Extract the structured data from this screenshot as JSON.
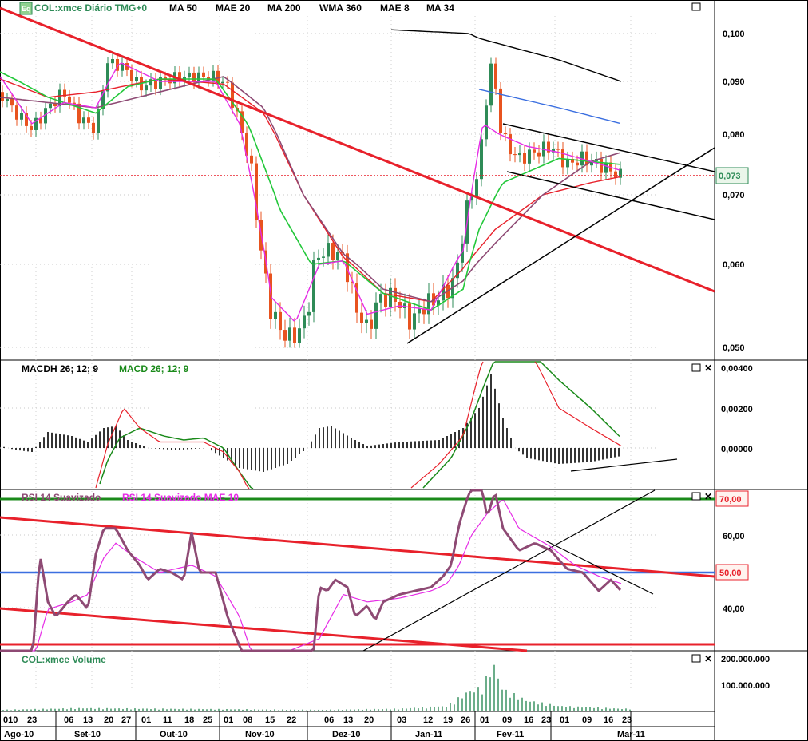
{
  "header": {
    "symbol": "COL:xmce Diário TMG+0",
    "indicators": [
      {
        "label": "MA 50",
        "color": "#e8212b"
      },
      {
        "label": "MAE 20",
        "color": "#23c83a"
      },
      {
        "label": "MA 200",
        "color": "#3b6fe0"
      },
      {
        "label": "WMA 360",
        "color": "#000000"
      },
      {
        "label": "MAE 8",
        "color": "#e62ce6"
      },
      {
        "label": "MA 34",
        "color": "#8e4a74"
      }
    ]
  },
  "panels": {
    "macd": {
      "labels": [
        {
          "label": "MACDH 26; 12; 9",
          "color": "#000000"
        },
        {
          "label": "MACD 26; 12; 9",
          "color": "#1a8a1a"
        }
      ]
    },
    "rsi": {
      "labels": [
        {
          "label": "RSI 14 Suavizado",
          "color": "#8e4a74"
        },
        {
          "label": "RSI 14 Suavizado MAE 10",
          "color": "#e62ce6"
        }
      ]
    },
    "volume": {
      "label": "COL:xmce Volume"
    }
  },
  "axes": {
    "price_ticks": [
      "0,100",
      "0,090",
      "0,080",
      "0,070",
      "0,060",
      "0,050"
    ],
    "price_last": "0,073",
    "macd_ticks": [
      "0,00400",
      "0,00200",
      "0,00000"
    ],
    "rsi_ticks": [
      "60,00",
      "40,00"
    ],
    "rsi_levels": [
      "70,00",
      "50,00"
    ],
    "volume_ticks": [
      "200.000.000",
      "100.000.000"
    ],
    "day_labels": [
      "010",
      "23",
      "06",
      "13",
      "20",
      "27",
      "01",
      "11",
      "18",
      "25",
      "01",
      "08",
      "15",
      "22",
      "06",
      "13",
      "20",
      "03",
      "12",
      "19",
      "26",
      "01",
      "09",
      "16",
      "23",
      "01",
      "09",
      "16",
      "23"
    ],
    "month_labels": [
      "Ago-10",
      "Set-10",
      "Out-10",
      "Nov-10",
      "Dez-10",
      "Jan-11",
      "Fev-11",
      "Mar-11"
    ]
  },
  "colors": {
    "ma50": "#e8212b",
    "mae20": "#23c83a",
    "ma200": "#3b6fe0",
    "wma360": "#000000",
    "mae8": "#e62ce6",
    "ma34": "#8e4a74",
    "up": "#2e8b57",
    "down": "#e8531f",
    "rsi": "#8e4a74",
    "macd": "#1a8a1a",
    "signal": "#e8212b"
  },
  "chart_data": {
    "type": "line",
    "title": "COL:xmce Diário TMG+0",
    "series": [
      {
        "name": "COL:xmce",
        "x": [
          "Ago-10",
          "Set-10",
          "Out-10",
          "Nov-10",
          "Dez-10",
          "Jan-11",
          "Fev-11",
          "Mar-11"
        ],
        "values": [
          0.088,
          0.09,
          0.091,
          0.053,
          0.061,
          0.055,
          0.078,
          0.073
        ]
      },
      {
        "name": "MA 200",
        "values": [
          null,
          null,
          null,
          null,
          null,
          null,
          0.088,
          0.082
        ]
      },
      {
        "name": "WMA 360",
        "values": [
          null,
          null,
          null,
          null,
          null,
          null,
          0.096,
          0.09
        ]
      }
    ],
    "ylim": [
      0.05,
      0.1
    ],
    "last_price": 0.073
  }
}
